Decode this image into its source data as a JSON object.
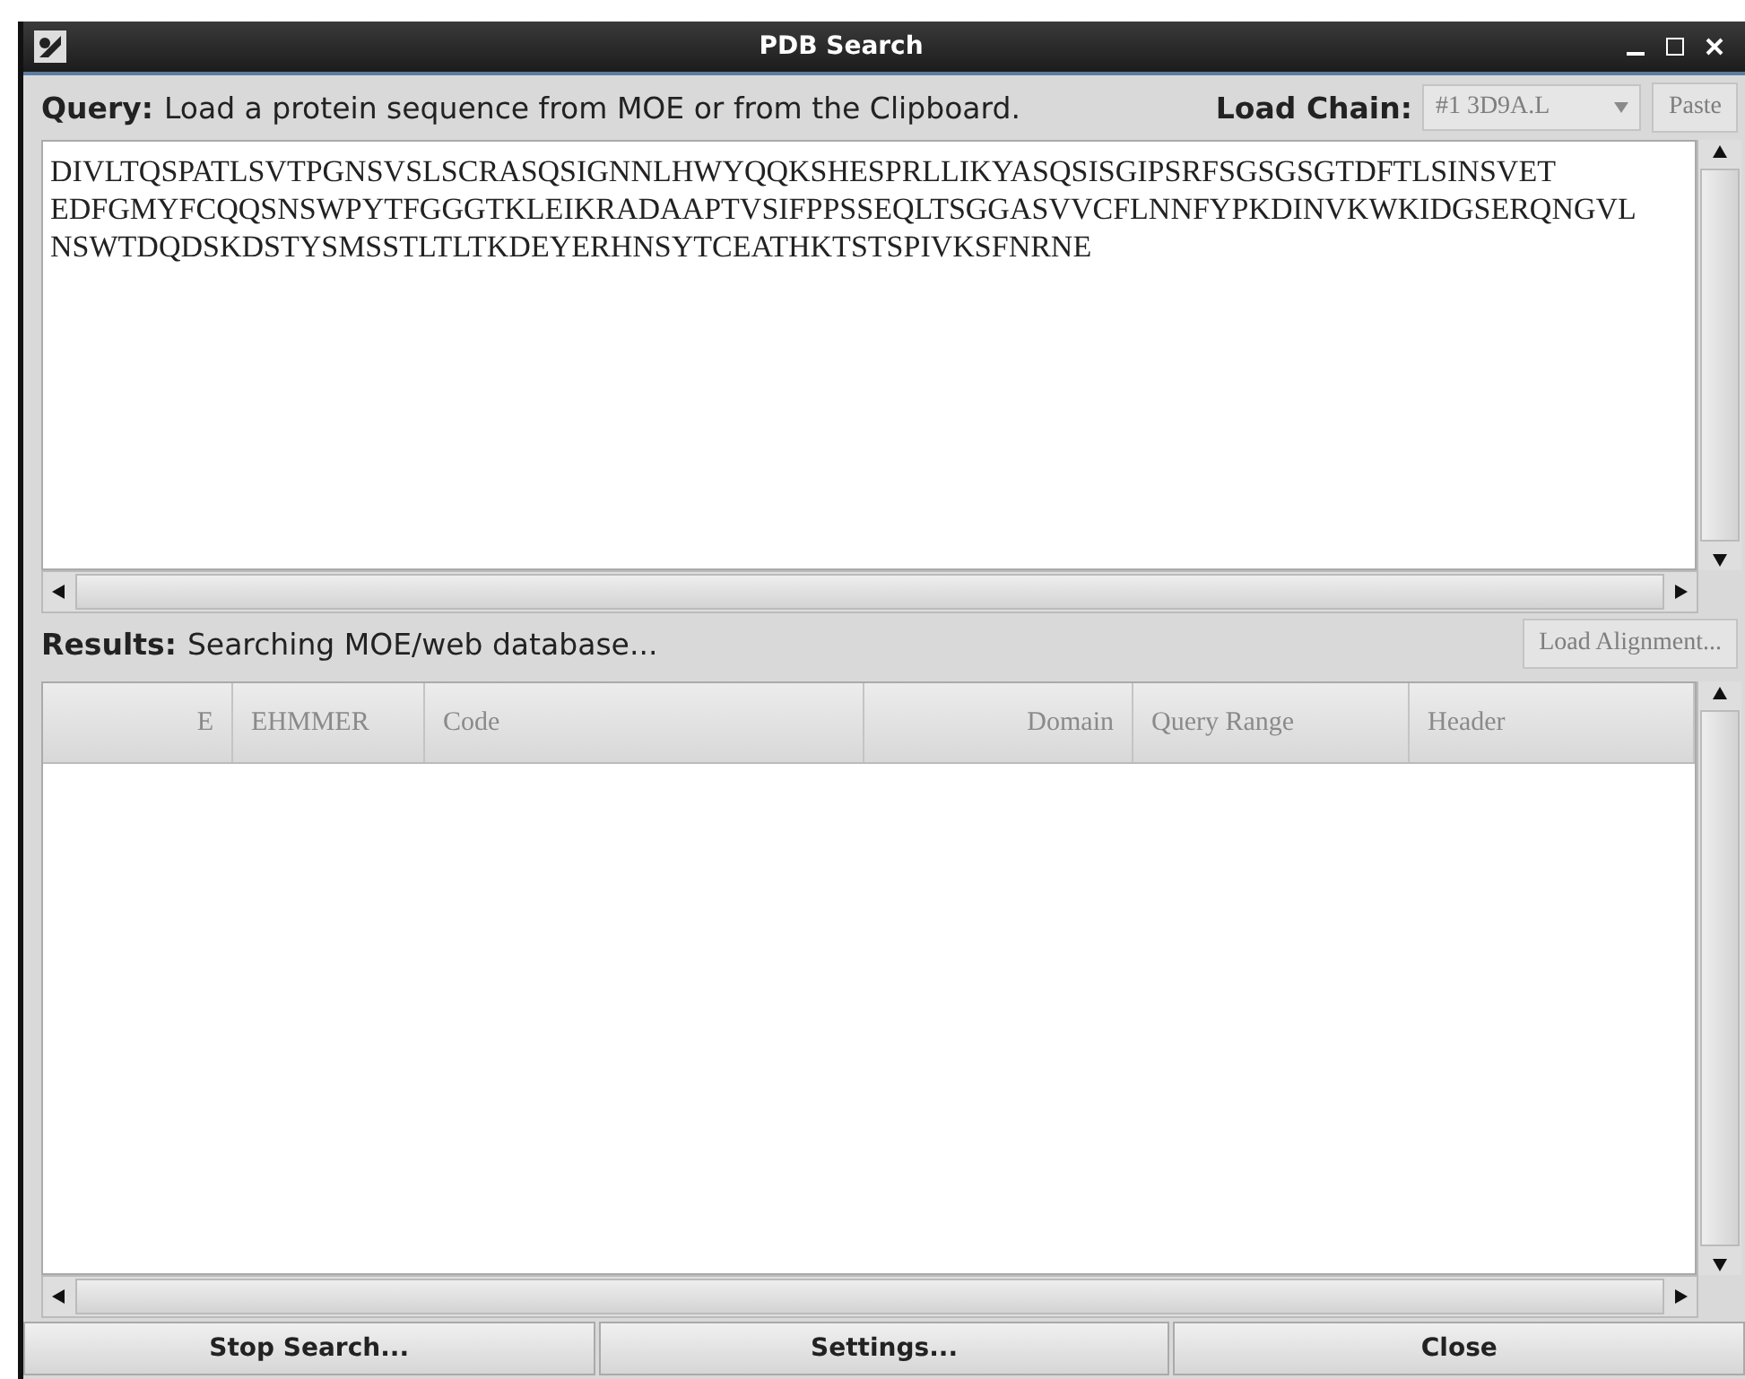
{
  "window": {
    "title": "PDB Search"
  },
  "query": {
    "label": "Query:",
    "hint": "Load a protein sequence from MOE or from the Clipboard.",
    "chain_label": "Load Chain:",
    "chain_select": {
      "value": "#1 3D9A.L",
      "disabled": true
    },
    "paste_button": {
      "label": "Paste",
      "disabled": true
    },
    "sequence_lines": [
      "DIVLTQSPATLSVTPGNSVSLSCRASQSIGNNLHWYQQKSHESPRLLIKYASQSISGIPSRFSGSGSGTDFTLSINSVET",
      "EDFGMYFCQQSNSWPYTFGGGTKLEIKRADAAPTVSIFPPSSEQLTSGGASVVCFLNNFYPKDINVKWKIDGSERQNGVL",
      "NSWTDQDSKDSTYSMSSTLTLTKDEYERHNSYTCEATHKTSTSPIVKSFNRNE"
    ]
  },
  "results": {
    "label": "Results:",
    "status": "Searching MOE/web database...",
    "load_alignment_button": {
      "label": "Load Alignment...",
      "disabled": true
    }
  },
  "table": {
    "disabled": true,
    "columns": [
      {
        "label": "E"
      },
      {
        "label": "EHMMER"
      },
      {
        "label": "Code"
      },
      {
        "label": "Domain"
      },
      {
        "label": "Query Range"
      },
      {
        "label": "Header"
      }
    ]
  },
  "buttons": [
    {
      "label": "Stop Search..."
    },
    {
      "label": "Settings..."
    },
    {
      "label": "Close"
    }
  ]
}
